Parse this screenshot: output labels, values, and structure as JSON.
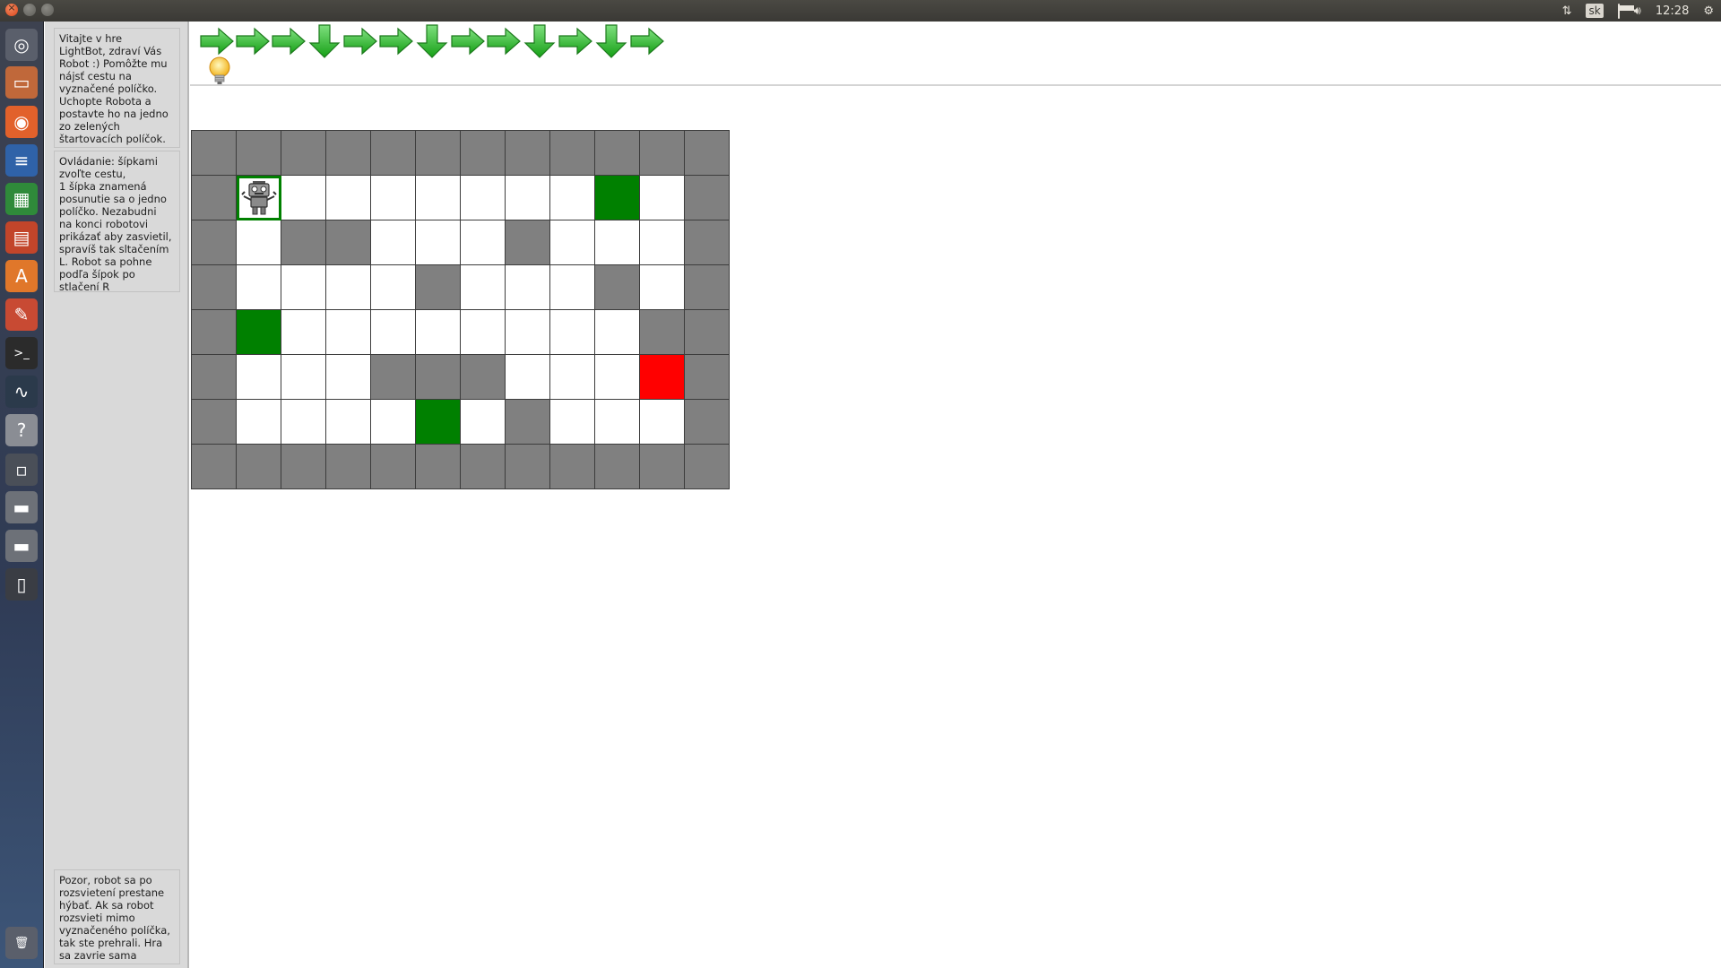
{
  "panel": {
    "keyboard_layout": "sk",
    "clock": "12:28"
  },
  "launcher": {
    "items": [
      "dash-icon",
      "files-icon",
      "firefox-icon",
      "writer-icon",
      "calc-icon",
      "impress-icon",
      "software-center-icon",
      "system-settings-icon",
      "terminal-icon",
      "system-monitor-icon",
      "help-icon",
      "workspace-switcher-icon",
      "drive-icon",
      "drive-icon",
      "phone-icon",
      "trash-icon"
    ]
  },
  "sidebar": {
    "welcome": "Vitajte v hre\nLightBot, zdraví Vás\nRobot :) Pomôžte mu\nnájsť cestu na\nvyznačené políčko.\nUchopte Robota a\npostavte ho na jedno\nzo zelených\nštartovacích políčok.",
    "controls": "Ovládanie: šípkami\nzvoľte cestu,\n 1 šípka znamená\nposunutie sa o jedno\npolíčko. Nezabudni\nna konci robotovi\nprikázať aby zasvietil,\nspravíš tak sltačením\nL. Robot sa pohne\npodľa šípok po\nstlačení R",
    "warning": "Pozor, robot sa po\nrozsvietení prestane\nhýbať. Ak sa robot\nrozsvieti mimo\nvyznačeného políčka,\ntak ste prehrali. Hra\nsa zavrie sama"
  },
  "program": [
    "right",
    "right",
    "right",
    "down",
    "right",
    "right",
    "down",
    "right",
    "right",
    "down",
    "right",
    "down",
    "right"
  ],
  "board": {
    "rows": [
      "WWWWWWWWWWWW",
      "WR.......S.W",
      "W.WW...W...W",
      "W....W...W.W",
      "WS........WW",
      "W...WWW...GW",
      "W....S.W...W",
      "WWWWWWWWWWWW"
    ],
    "legend": {
      "W": "wall",
      ".": "free",
      "S": "start",
      "G": "goal",
      "R": "robot"
    },
    "colors": {
      "wall": "#808080",
      "free": "#ffffff",
      "start": "#008000",
      "goal": "#ff0000"
    }
  }
}
